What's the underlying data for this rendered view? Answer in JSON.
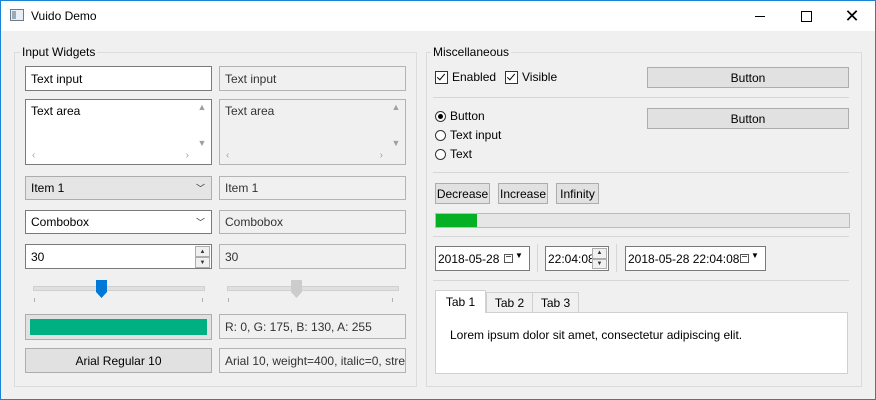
{
  "window": {
    "title": "Vuido Demo",
    "minimize_glyph": "minimize-icon",
    "maximize_glyph": "maximize-icon",
    "close_glyph": "✕"
  },
  "input_widgets": {
    "title": "Input Widgets",
    "text_input": "Text input",
    "text_input_disabled": "Text input",
    "text_area": "Text area",
    "text_area_disabled": "Text area",
    "select": "Item 1",
    "select_disabled": "Item 1",
    "combobox": "Combobox",
    "combobox_disabled": "Combobox",
    "number": "30",
    "number_disabled": "30",
    "slider_value": 0.4,
    "color_hex": "#00af82",
    "color_text": "R: 0, G: 175, B: 130, A: 255",
    "font_button": "Arial Regular 10",
    "font_text": "Arial 10, weight=400, italic=0, stre"
  },
  "misc": {
    "title": "Miscellaneous",
    "enabled_label": "Enabled",
    "visible_label": "Visible",
    "button1": "Button",
    "button2": "Button",
    "radio_button": "Button",
    "radio_text_input": "Text input",
    "radio_text": "Text",
    "decrease": "Decrease",
    "increase": "Increase",
    "infinity": "Infinity",
    "progress": 0.1,
    "date": "2018-05-28",
    "time": "22:04:08",
    "datetime": "2018-05-28 22:04:08",
    "tabs": [
      "Tab 1",
      "Tab 2",
      "Tab 3"
    ],
    "tab_content": "Lorem ipsum dolor sit amet, consectetur adipiscing elit."
  },
  "colors": {
    "accent": "#1883d7",
    "progress": "#06b025",
    "slider_thumb": "#0078d7"
  }
}
